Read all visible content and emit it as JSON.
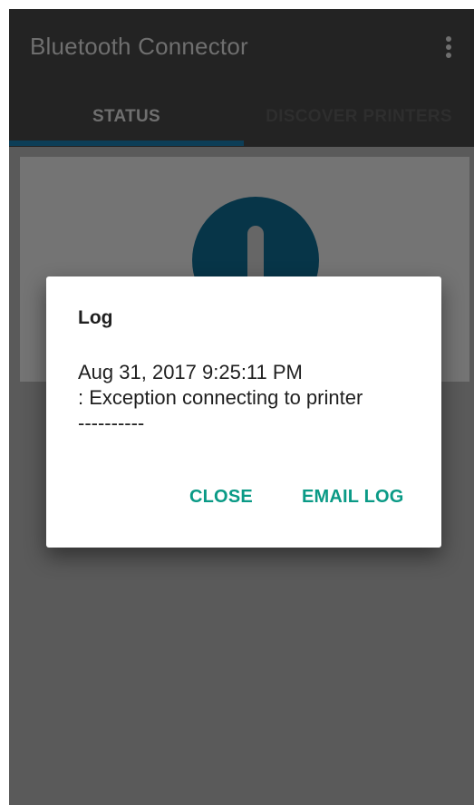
{
  "app_bar": {
    "title": "Bluetooth Connector",
    "overflow_icon": "more-vert-icon"
  },
  "tabs": [
    {
      "label": "STATUS",
      "selected": true
    },
    {
      "label": "DISCOVER PRINTERS",
      "selected": false
    }
  ],
  "status_card": {
    "icon": "exclamation-icon",
    "icon_color": "#073548"
  },
  "dialog": {
    "title": "Log",
    "lines": [
      "Aug 31, 2017 9:25:11 PM",
      ": Exception connecting to printer",
      "----------"
    ],
    "buttons": {
      "close_label": "CLOSE",
      "email_label": "EMAIL LOG"
    },
    "accent_color": "#0a9a86"
  }
}
